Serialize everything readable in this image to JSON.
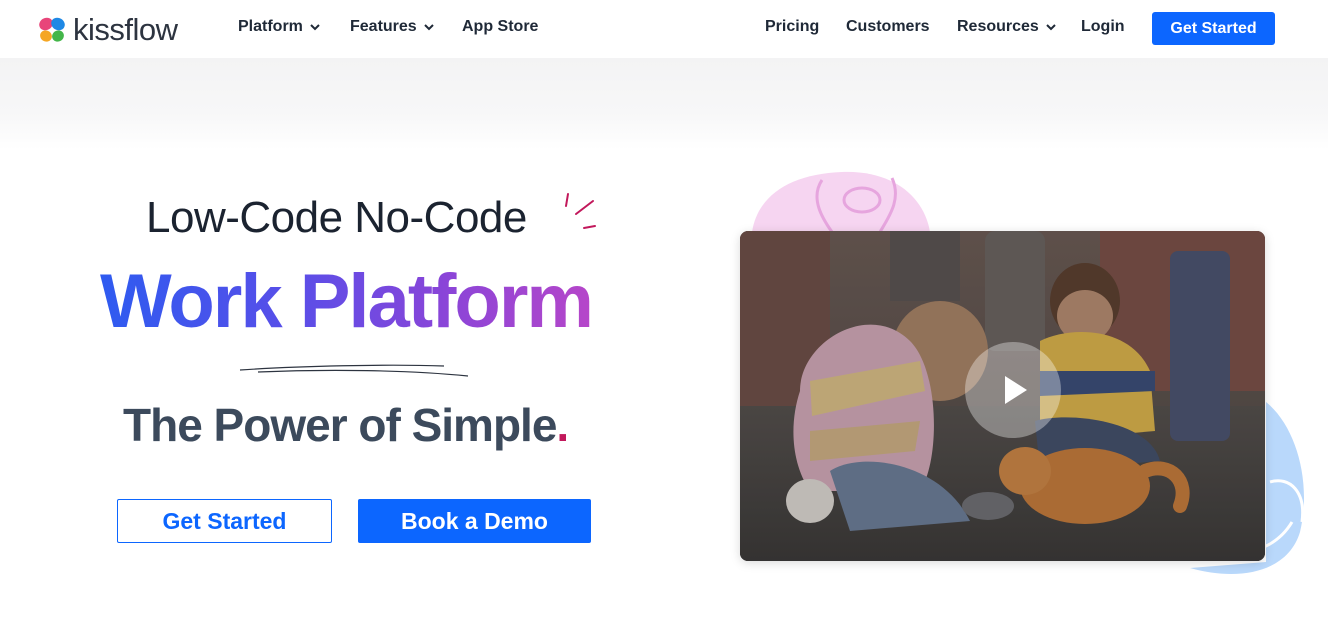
{
  "brand": {
    "name": "kissflow"
  },
  "nav": {
    "left_items": [
      {
        "label": "Platform",
        "dropdown": true
      },
      {
        "label": "Features",
        "dropdown": true
      },
      {
        "label": "App Store",
        "dropdown": false
      }
    ],
    "right_items": [
      {
        "label": "Pricing",
        "dropdown": false
      },
      {
        "label": "Customers",
        "dropdown": false
      },
      {
        "label": "Resources",
        "dropdown": true
      },
      {
        "label": "Login",
        "dropdown": false
      }
    ],
    "cta_label": "Get Started"
  },
  "hero": {
    "subtitle": "Low-Code No-Code",
    "title": "Work Platform",
    "tagline": "The Power of Simple",
    "tagline_dot": ".",
    "primary_button": "Get Started",
    "secondary_button": "Book a Demo"
  },
  "video": {
    "play_icon": "play-icon"
  },
  "colors": {
    "brand_blue": "#0c66ff",
    "title_gradient_start": "#2e5bf0",
    "title_gradient_end": "#b646c9",
    "accent_pink": "#c2185b",
    "blob_pink": "#f6d5f1",
    "blob_blue": "#b9d8fb"
  }
}
